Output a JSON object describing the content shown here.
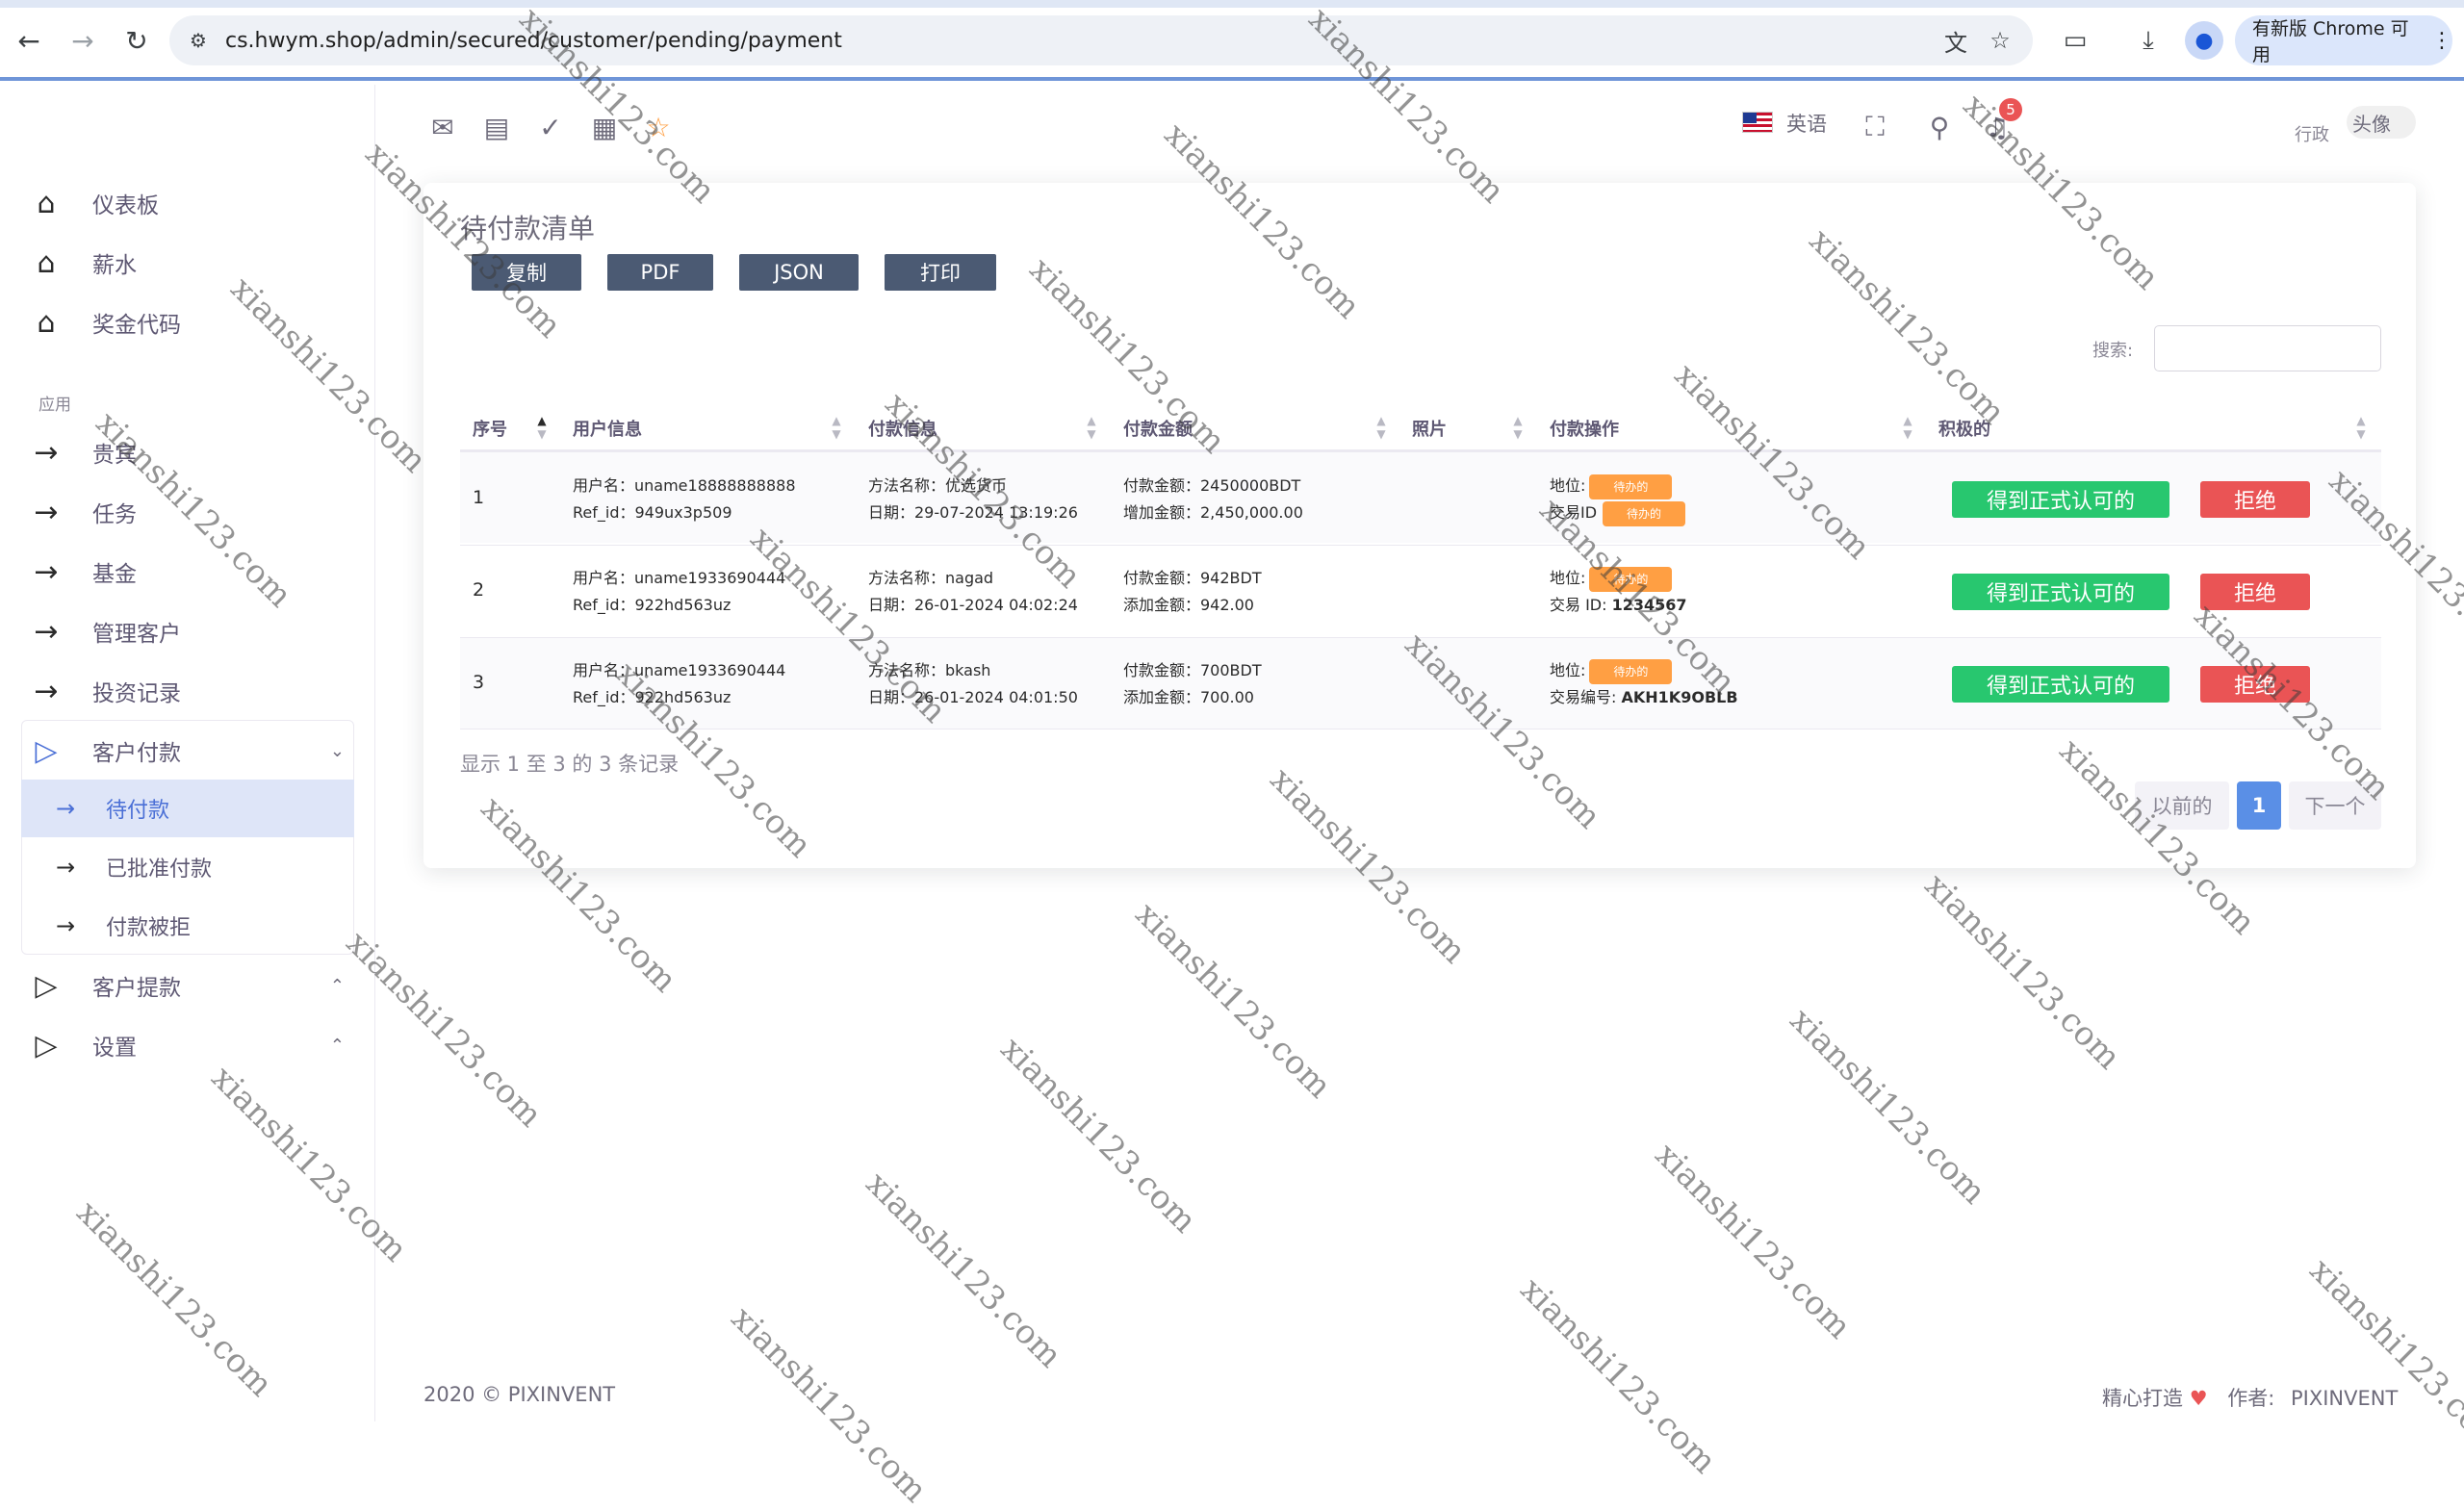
{
  "browser": {
    "url": "cs.hwym.shop/admin/secured/customer/pending/payment",
    "update_label": "有新版 Chrome 可用",
    "icons": [
      "back-icon",
      "forward-icon",
      "reload-icon",
      "site-info-icon",
      "translate-icon",
      "bookmark-star-icon",
      "extensions-icon",
      "download-icon",
      "profile-icon",
      "menu-dots-icon"
    ]
  },
  "sidebar": {
    "top_items": [
      {
        "label": "仪表板",
        "icon": "home-icon"
      },
      {
        "label": "薪水",
        "icon": "home-icon"
      },
      {
        "label": "奖金代码",
        "icon": "home-icon"
      }
    ],
    "section_heading": "应用",
    "app_items": [
      {
        "label": "贵宾",
        "icon": "arrow-right-icon"
      },
      {
        "label": "任务",
        "icon": "arrow-right-icon"
      },
      {
        "label": "基金",
        "icon": "arrow-right-icon"
      },
      {
        "label": "管理客户",
        "icon": "arrow-right-icon"
      },
      {
        "label": "投资记录",
        "icon": "arrow-right-icon"
      }
    ],
    "customer_payment": {
      "label": "客户付款",
      "children": [
        {
          "label": "待付款",
          "active": true
        },
        {
          "label": "已批准付款",
          "active": false
        },
        {
          "label": "付款被拒",
          "active": false
        }
      ]
    },
    "withdraw": {
      "label": "客户提款"
    },
    "settings": {
      "label": "设置"
    }
  },
  "header": {
    "language": "英语",
    "notification_count": "5",
    "role": "行政",
    "avatar_alt": "头像"
  },
  "card": {
    "title": "待付款清单",
    "export_buttons": [
      "复制",
      "PDF",
      "JSON",
      "打印"
    ],
    "search_label": "搜索:",
    "search_value": "",
    "columns": [
      "序号",
      "用户信息",
      "付款信息",
      "付款金额",
      "照片",
      "付款操作",
      "积极的"
    ],
    "rows": [
      {
        "index": "1",
        "user_line1": "用户名：uname18888888888",
        "user_line2": "Ref_id：949ux3p509",
        "pay_line1": "方法名称：优选货币",
        "pay_line2": "日期：29-07-2024 13:19:26",
        "amount_line1": "付款金额：2450000BDT",
        "amount_line2": "增加金额：2,450,000.00",
        "status_label": "地位:",
        "status_badge": "待办的",
        "tx_label": "交易ID",
        "tx_value": "待办的",
        "approve": "得到正式认可的",
        "reject": "拒绝"
      },
      {
        "index": "2",
        "user_line1": "用户名：uname1933690444",
        "user_line2": "Ref_id：922hd563uz",
        "pay_line1": "方法名称：nagad",
        "pay_line2": "日期：26-01-2024 04:02:24",
        "amount_line1": "付款金额：942BDT",
        "amount_line2": "添加金额：942.00",
        "status_label": "地位:",
        "status_badge": "待办的",
        "tx_label": "交易 ID:",
        "tx_value": "1234567",
        "approve": "得到正式认可的",
        "reject": "拒绝"
      },
      {
        "index": "3",
        "user_line1": "用户名：uname1933690444",
        "user_line2": "Ref_id：922hd563uz",
        "pay_line1": "方法名称：bkash",
        "pay_line2": "日期：26-01-2024 04:01:50",
        "amount_line1": "付款金额：700BDT",
        "amount_line2": "添加金额：700.00",
        "status_label": "地位:",
        "status_badge": "待办的",
        "tx_label": "交易编号:",
        "tx_value": "AKH1K9OBLB",
        "approve": "得到正式认可的",
        "reject": "拒绝"
      }
    ],
    "info": "显示 1 至 3 的 3 条记录",
    "pagination": {
      "prev": "以前的",
      "current": "1",
      "next": "下一个"
    }
  },
  "footer": {
    "copyright": "2020 © PIXINVENT",
    "made_with": "精心打造",
    "author_label": "作者:",
    "author": "PIXINVENT"
  },
  "watermark": "xianshi123.com",
  "colors": {
    "approve": "#28c76f",
    "reject": "#ea5455",
    "pending_badge": "#ff9f43",
    "export_button": "#4b5a73",
    "active_menu": "#dee5f8"
  }
}
